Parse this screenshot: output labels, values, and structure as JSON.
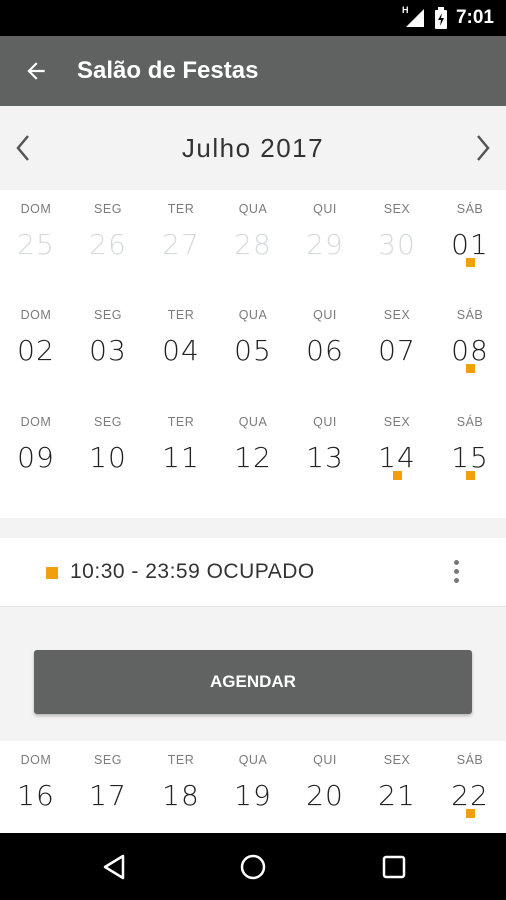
{
  "status_bar": {
    "network_type": "H",
    "time": "7:01",
    "icons": [
      "signal-icon",
      "battery-icon"
    ]
  },
  "app_bar": {
    "back_icon": "arrow-left-icon",
    "title": "Salão de Festas"
  },
  "month_nav": {
    "label": "Julho 2017",
    "prev_icon": "chevron-left-icon",
    "next_icon": "chevron-right-icon"
  },
  "weeks": [
    {
      "days": [
        {
          "dow": "DOM",
          "num": "25",
          "muted": true,
          "marked": false
        },
        {
          "dow": "SEG",
          "num": "26",
          "muted": true,
          "marked": false
        },
        {
          "dow": "TER",
          "num": "27",
          "muted": true,
          "marked": false
        },
        {
          "dow": "QUA",
          "num": "28",
          "muted": true,
          "marked": false
        },
        {
          "dow": "QUI",
          "num": "29",
          "muted": true,
          "marked": false
        },
        {
          "dow": "SEX",
          "num": "30",
          "muted": true,
          "marked": false
        },
        {
          "dow": "SÁB",
          "num": "01",
          "muted": false,
          "marked": true
        }
      ]
    },
    {
      "days": [
        {
          "dow": "DOM",
          "num": "02",
          "muted": false,
          "marked": false
        },
        {
          "dow": "SEG",
          "num": "03",
          "muted": false,
          "marked": false
        },
        {
          "dow": "TER",
          "num": "04",
          "muted": false,
          "marked": false
        },
        {
          "dow": "QUA",
          "num": "05",
          "muted": false,
          "marked": false
        },
        {
          "dow": "QUI",
          "num": "06",
          "muted": false,
          "marked": false
        },
        {
          "dow": "SEX",
          "num": "07",
          "muted": false,
          "marked": false
        },
        {
          "dow": "SÁB",
          "num": "08",
          "muted": false,
          "marked": true
        }
      ]
    },
    {
      "days": [
        {
          "dow": "DOM",
          "num": "09",
          "muted": false,
          "marked": false
        },
        {
          "dow": "SEG",
          "num": "10",
          "muted": false,
          "marked": false
        },
        {
          "dow": "TER",
          "num": "11",
          "muted": false,
          "marked": false
        },
        {
          "dow": "QUA",
          "num": "12",
          "muted": false,
          "marked": false
        },
        {
          "dow": "QUI",
          "num": "13",
          "muted": false,
          "marked": false
        },
        {
          "dow": "SEX",
          "num": "14",
          "muted": false,
          "marked": true
        },
        {
          "dow": "SÁB",
          "num": "15",
          "muted": false,
          "marked": true
        }
      ]
    },
    {
      "days": [
        {
          "dow": "DOM",
          "num": "16",
          "muted": false,
          "marked": false
        },
        {
          "dow": "SEG",
          "num": "17",
          "muted": false,
          "marked": false
        },
        {
          "dow": "TER",
          "num": "18",
          "muted": false,
          "marked": false
        },
        {
          "dow": "QUA",
          "num": "19",
          "muted": false,
          "marked": false
        },
        {
          "dow": "QUI",
          "num": "20",
          "muted": false,
          "marked": false
        },
        {
          "dow": "SEX",
          "num": "21",
          "muted": false,
          "marked": false
        },
        {
          "dow": "SÁB",
          "num": "22",
          "muted": false,
          "marked": true
        }
      ]
    }
  ],
  "event": {
    "text": "10:30 - 23:59 OCUPADO",
    "more_icon": "more-vertical-icon"
  },
  "schedule_button": {
    "label": "AGENDAR"
  },
  "system_nav": {
    "icons": [
      "back-triangle-icon",
      "home-circle-icon",
      "recents-square-icon"
    ]
  },
  "colors": {
    "app_bar": "#606161",
    "accent_marker": "#f29f0c",
    "button": "#616262",
    "muted_day": "#d6dadc"
  }
}
